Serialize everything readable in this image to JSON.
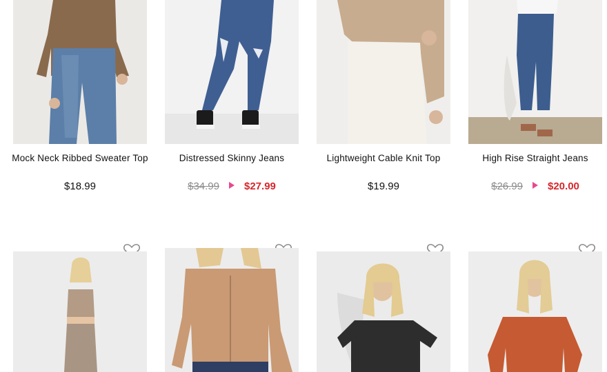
{
  "colors": {
    "sale_price": "#d6262b",
    "old_price": "#8a8a8a",
    "arrow": "#e64a8e",
    "thumb_bg": "#ececec"
  },
  "products_row1": [
    {
      "title": "Mock Neck Ribbed Sweater Top",
      "price": "$18.99",
      "old_price": null,
      "sale_price": null
    },
    {
      "title": "Distressed Skinny Jeans",
      "price": null,
      "old_price": "$34.99",
      "sale_price": "$27.99"
    },
    {
      "title": "Lightweight Cable Knit Top",
      "price": "$19.99",
      "old_price": null,
      "sale_price": null
    },
    {
      "title": "High Rise Straight Jeans",
      "price": null,
      "old_price": "$26.99",
      "sale_price": "$20.00"
    }
  ],
  "products_row2": [
    {
      "icon": "heart-icon"
    },
    {
      "icon": "heart-icon"
    },
    {
      "icon": "heart-icon"
    },
    {
      "icon": "heart-icon"
    }
  ]
}
